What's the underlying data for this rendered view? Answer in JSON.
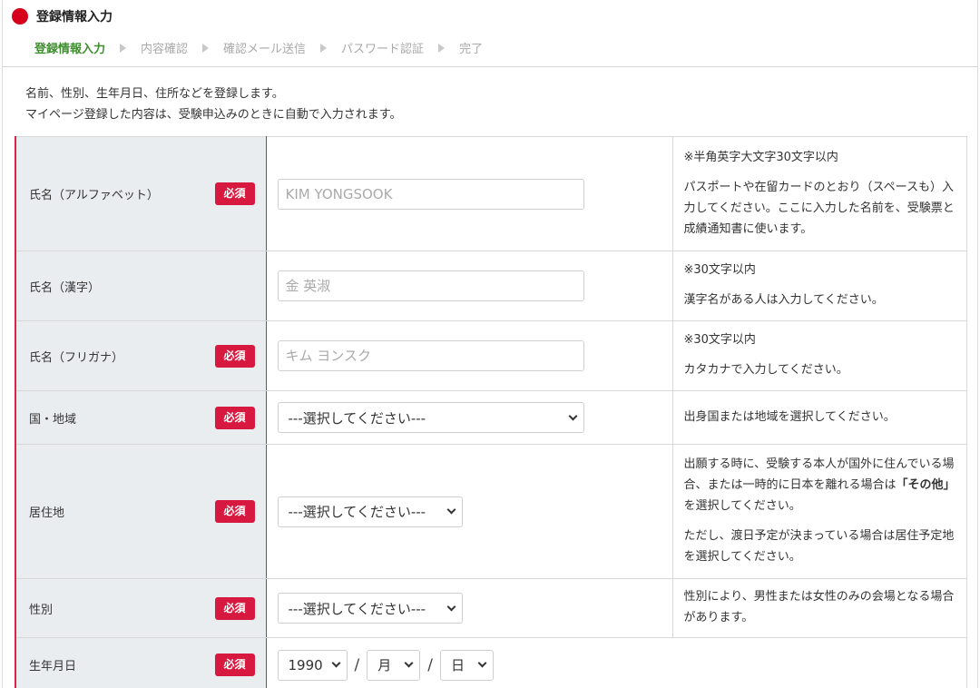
{
  "header": {
    "title": "登録情報入力",
    "steps": [
      "登録情報入力",
      "内容確認",
      "確認メール送信",
      "パスワード認証",
      "完了"
    ],
    "active_step": 0
  },
  "intro": {
    "line1": "名前、性別、生年月日、住所などを登録します。",
    "line2": "マイページ登録した内容は、受験申込みのときに自動で入力されます。"
  },
  "required_label": "必須",
  "fields": {
    "name_alpha": {
      "label": "氏名（アルファベット）",
      "placeholder": "KIM YONGSOOK",
      "note1": "※半角英字大文字30文字以内",
      "note2": "パスポートや在留カードのとおり（スペースも）入力してください。ここに入力した名前を、受験票と成績通知書に使います。"
    },
    "name_kanji": {
      "label": "氏名（漢字）",
      "placeholder": "金 英淑",
      "note1": "※30文字以内",
      "note2": "漢字名がある人は入力してください。"
    },
    "name_kana": {
      "label": "氏名（フリガナ）",
      "placeholder": "キム ヨンスク",
      "note1": "※30文字以内",
      "note2": "カタカナで入力してください。"
    },
    "country": {
      "label": "国・地域",
      "selected": "---選択してください---",
      "note1": "出身国または地域を選択してください。"
    },
    "residence": {
      "label": "居住地",
      "selected": "---選択してください---",
      "note1_a": "出願する時に、受験する本人が国外に住んでいる場合、または一時的に日本を離れる場合は",
      "note1_b": "「その他」",
      "note1_c": "を選択してください。",
      "note2": "ただし、渡日予定が決まっている場合は居住予定地を選択してください。"
    },
    "gender": {
      "label": "性別",
      "selected": "---選択してください---",
      "note1": "性別により、男性または女性のみの会場となる場合があります。"
    },
    "birthdate": {
      "label": "生年月日",
      "year": "1990",
      "month": "月",
      "day": "日",
      "separator": "/"
    }
  }
}
